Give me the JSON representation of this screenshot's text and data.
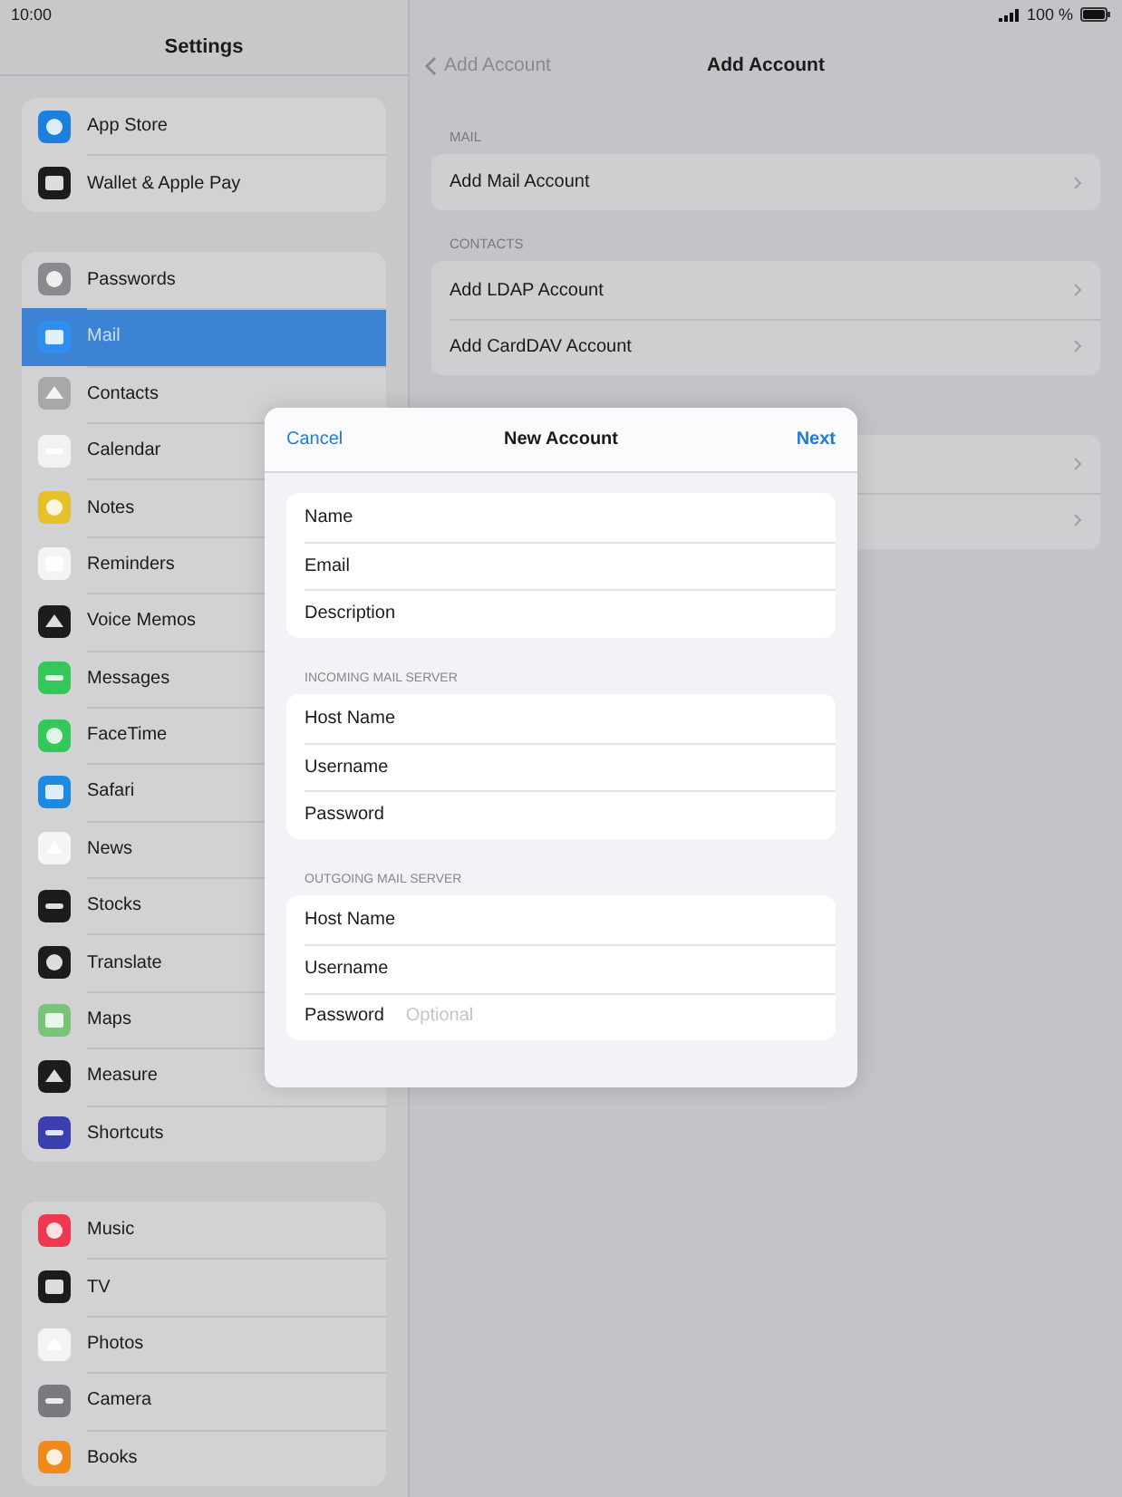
{
  "status_bar": {
    "time": "10:00",
    "battery": "100 %"
  },
  "sidebar": {
    "title": "Settings",
    "groups": [
      {
        "items": [
          {
            "label": "App Store",
            "color": "#1c7fe0",
            "selected": false
          },
          {
            "label": "Wallet & Apple Pay",
            "color": "#1c1c1e",
            "selected": false
          }
        ]
      },
      {
        "items": [
          {
            "label": "Passwords",
            "color": "#8a8a8e",
            "selected": false
          },
          {
            "label": "Mail",
            "color": "#2f8ef0",
            "selected": true
          },
          {
            "label": "Contacts",
            "color": "#a8a8aa",
            "selected": false
          },
          {
            "label": "Calendar",
            "color": "#f2f2f2",
            "selected": false
          },
          {
            "label": "Notes",
            "color": "#e6c02a",
            "selected": false
          },
          {
            "label": "Reminders",
            "color": "#f4f4f4",
            "selected": false
          },
          {
            "label": "Voice Memos",
            "color": "#1c1c1e",
            "selected": false
          },
          {
            "label": "Messages",
            "color": "#34c759",
            "selected": false
          },
          {
            "label": "FaceTime",
            "color": "#34c759",
            "selected": false
          },
          {
            "label": "Safari",
            "color": "#1e88e5",
            "selected": false
          },
          {
            "label": "News",
            "color": "#f5f5f5",
            "selected": false
          },
          {
            "label": "Stocks",
            "color": "#1c1c1e",
            "selected": false
          },
          {
            "label": "Translate",
            "color": "#1c1c1e",
            "selected": false
          },
          {
            "label": "Maps",
            "color": "#7ac47a",
            "selected": false
          },
          {
            "label": "Measure",
            "color": "#1c1c1e",
            "selected": false
          },
          {
            "label": "Shortcuts",
            "color": "#3b3fb0",
            "selected": false
          }
        ]
      },
      {
        "items": [
          {
            "label": "Music",
            "color": "#f0394f",
            "selected": false
          },
          {
            "label": "TV",
            "color": "#1c1c1e",
            "selected": false
          },
          {
            "label": "Photos",
            "color": "#f4f4f4",
            "selected": false
          },
          {
            "label": "Camera",
            "color": "#7a7a7e",
            "selected": false
          },
          {
            "label": "Books",
            "color": "#f08a1c",
            "selected": false
          }
        ]
      }
    ]
  },
  "detail": {
    "back_label": "Add Account",
    "title": "Add Account",
    "sections": [
      {
        "header": "MAIL",
        "rows": [
          {
            "kind": "link",
            "label": "Add Mail Account"
          }
        ]
      },
      {
        "header": "CONTACTS",
        "rows": [
          {
            "kind": "link",
            "label": "Add LDAP Account"
          },
          {
            "kind": "link",
            "label": "Add CardDAV Account"
          }
        ]
      },
      {
        "rows": [
          {
            "kind": "covered"
          },
          {
            "kind": "covered"
          }
        ]
      }
    ]
  },
  "modal": {
    "cancel": "Cancel",
    "title": "New Account",
    "next": "Next",
    "sections": [
      {
        "fields": [
          {
            "label": "Name"
          },
          {
            "label": "Email"
          },
          {
            "label": "Description"
          }
        ]
      },
      {
        "header": "INCOMING MAIL SERVER",
        "fields": [
          {
            "label": "Host Name"
          },
          {
            "label": "Username"
          },
          {
            "label": "Password"
          }
        ]
      },
      {
        "header": "OUTGOING MAIL SERVER",
        "fields": [
          {
            "label": "Host Name"
          },
          {
            "label": "Username"
          },
          {
            "label": "Password",
            "placeholder": "Optional"
          }
        ]
      }
    ]
  }
}
